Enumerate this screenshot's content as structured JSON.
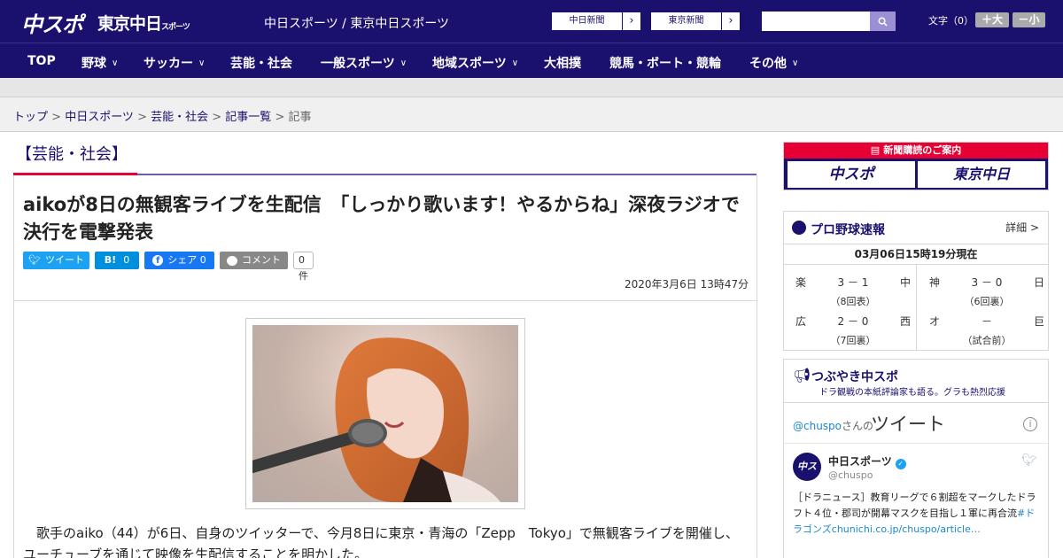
{
  "header": {
    "logo_chuspo": "中スポ",
    "logo_tokyo": "東京中日",
    "logo_tokyo_small": "スポーツ",
    "site_title": "中日スポーツ / 東京中日スポーツ",
    "ext_links": [
      {
        "label": "中日新聞"
      },
      {
        "label": "東京新聞"
      }
    ],
    "search_placeholder": "",
    "fontsize_label": "文字（0）",
    "fontsize_up": "＋大",
    "fontsize_down": "－小"
  },
  "nav": [
    {
      "label": "TOP",
      "dropdown": false
    },
    {
      "label": "野球",
      "dropdown": true
    },
    {
      "label": "サッカー",
      "dropdown": true
    },
    {
      "label": "芸能・社会",
      "dropdown": false
    },
    {
      "label": "一般スポーツ",
      "dropdown": true
    },
    {
      "label": "地域スポーツ",
      "dropdown": true
    },
    {
      "label": "大相撲",
      "dropdown": false
    },
    {
      "label": "競馬・ボート・競輪",
      "dropdown": false
    },
    {
      "label": "その他",
      "dropdown": true
    }
  ],
  "breadcrumb": {
    "items": [
      "トップ",
      "中日スポーツ",
      "芸能・社会",
      "記事一覧"
    ],
    "current": "記事",
    "separator": " > "
  },
  "article": {
    "category": "【芸能・社会】",
    "headline": "aikoが8日の無観客ライブを生配信　「しっかり歌います！やるからね」深夜ラジオで決行を電撃発表",
    "share": {
      "tweet": "ツイート",
      "hatena_count": "0",
      "fb_share": "シェア 0",
      "comment": "コメント",
      "comment_count": "0件"
    },
    "date": "2020年3月6日 13時47分",
    "body": "歌手のaiko（44）が6日、自身のツイッターで、今月8日に東京・青海の「Zepp　Tokyo」で無観客ライブを開催し、ユーチューブを通じて映像を生配信することを明かした。"
  },
  "sidebar": {
    "subscription": {
      "title": "新聞購読のご案内",
      "logo1": "中スポ",
      "logo2": "東京中日"
    },
    "npb": {
      "title": "プロ野球速報",
      "detail": "詳細 >",
      "time": "03月06日15時19分現在",
      "games": [
        {
          "team1": "楽",
          "score": "3 － 1",
          "team2": "中",
          "status": "（8回表）"
        },
        {
          "team1": "神",
          "score": "3 － 0",
          "team2": "日",
          "status": "（6回裏）"
        },
        {
          "team1": "広",
          "score": "2 － 0",
          "team2": "西",
          "status": "（7回裏）"
        },
        {
          "team1": "オ",
          "score": "－",
          "team2": "巨",
          "status": "（試合前）"
        }
      ]
    },
    "tweets": {
      "title": "つぶやき中スポ",
      "subtitle": "ドラ観戦の本紙評論家も語る。グラも熱烈応援",
      "handle": "@chuspo",
      "handle_suffix": "さんの",
      "header": "ツイート",
      "info": "i",
      "avatar_text": "中スポ",
      "name": "中日スポーツ",
      "user": "@chuspo",
      "text": "［ドラニュース］教育リーグで６割超をマークしたドラフト４位・郡司が開幕マスクを目指し１軍に再合流",
      "link": "#ドラゴンズchunichi.co.jp/chuspo/article…"
    }
  }
}
